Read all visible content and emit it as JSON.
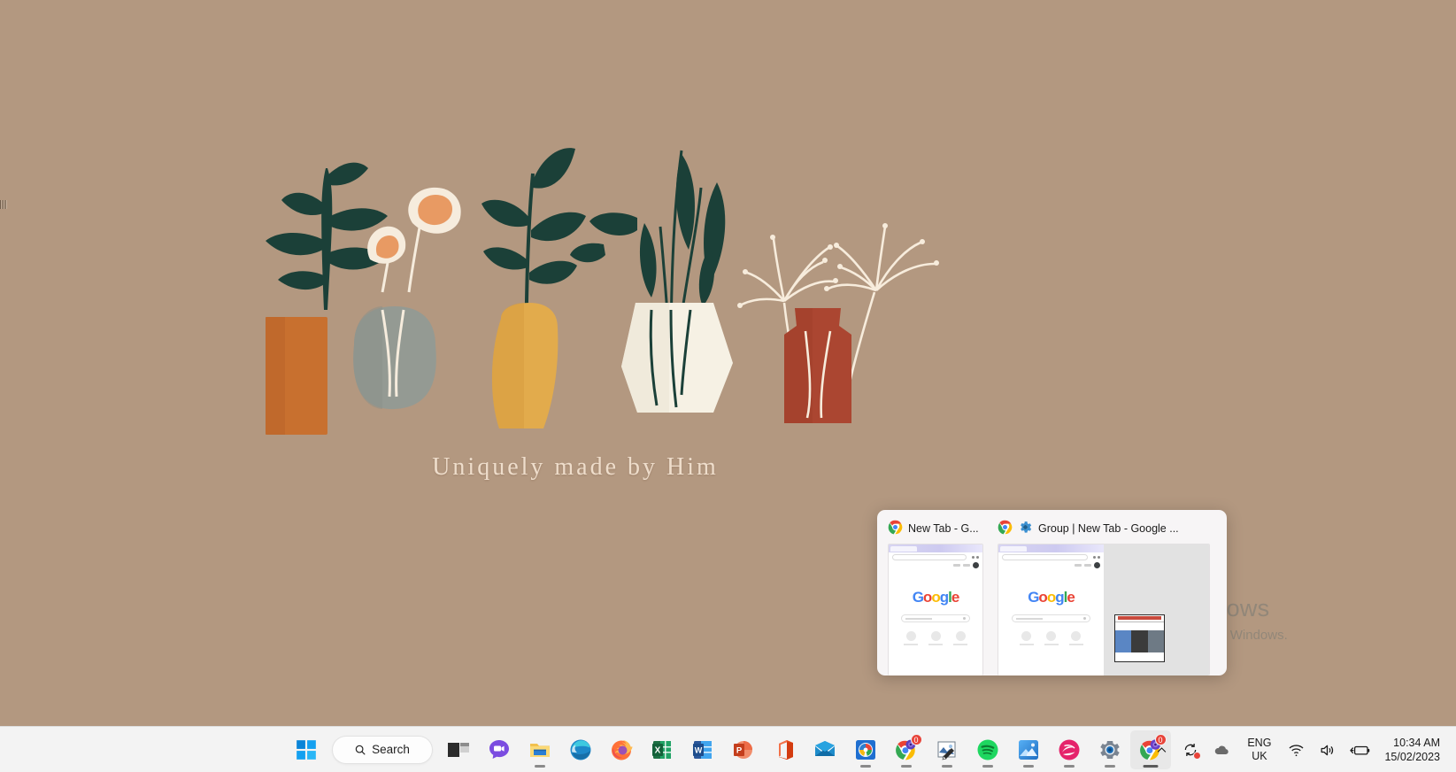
{
  "desktop": {
    "wallpaper": {
      "background_color": "#b39880",
      "caption": "Uniquely made by Him",
      "caption_color": "#f3e3d2",
      "vases": [
        {
          "name": "terracotta-orange-rectangular-vase",
          "color": "#c8702f",
          "plant": "fern-branch",
          "plant_color": "#1b4038"
        },
        {
          "name": "grey-round-vase",
          "color": "#949a93",
          "plant": "two-poppy-flowers",
          "plant_color": "#f5e9d8"
        },
        {
          "name": "mustard-yellow-pear-vase",
          "color": "#e2ab4c",
          "plant": "leafy-branch",
          "plant_color": "#1b4038"
        },
        {
          "name": "cream-white-geometric-vase",
          "color": "#f6f1e4",
          "plant": "tall-leaf-stems",
          "plant_color": "#1b4038"
        },
        {
          "name": "rust-red-bottle-vase",
          "color": "#ab4631",
          "plant": "dandelion-stems",
          "plant_color": "#f7ecdc"
        }
      ]
    }
  },
  "watermark": {
    "title": "Activate Windows",
    "subtitle": "Go to Settings to activate Windows."
  },
  "thumbnail_preview": {
    "items": [
      {
        "name": "chrome-new-tab-thumbnail",
        "title": "New Tab - G...",
        "icons": [
          "chrome-icon"
        ],
        "page": "Google"
      },
      {
        "name": "chrome-group-thumbnail",
        "title": "Group | New Tab - Google ...",
        "icons": [
          "chrome-icon",
          "gear-icon"
        ],
        "page": "Google"
      }
    ],
    "google_letters": [
      "G",
      "o",
      "o",
      "g",
      "l",
      "e"
    ]
  },
  "taskbar": {
    "start": {
      "name": "start-button",
      "label": "Start"
    },
    "search": {
      "placeholder": "Search",
      "label": "Search"
    },
    "items": [
      {
        "name": "taskview-button",
        "icon": "task-view-icon",
        "running": false,
        "badge": null
      },
      {
        "name": "teams-button",
        "icon": "teams-chat-icon",
        "running": false,
        "badge": null
      },
      {
        "name": "file-explorer-button",
        "icon": "folder-icon",
        "running": true,
        "badge": null
      },
      {
        "name": "edge-button",
        "icon": "edge-icon",
        "running": false,
        "badge": null
      },
      {
        "name": "firefox-button",
        "icon": "firefox-icon",
        "running": false,
        "badge": null
      },
      {
        "name": "excel-button",
        "icon": "excel-icon",
        "running": false,
        "badge": null
      },
      {
        "name": "word-button",
        "icon": "word-icon",
        "running": false,
        "badge": null
      },
      {
        "name": "powerpoint-button",
        "icon": "powerpoint-icon",
        "running": false,
        "badge": null
      },
      {
        "name": "office-button",
        "icon": "office-icon",
        "running": false,
        "badge": null
      },
      {
        "name": "mail-button",
        "icon": "mail-icon",
        "running": false,
        "badge": null
      },
      {
        "name": "store-button",
        "icon": "microsoft-store-icon",
        "running": true,
        "badge": null
      },
      {
        "name": "chrome-canary-button",
        "icon": "chrome-canary-icon",
        "running": true,
        "badge": "0"
      },
      {
        "name": "snip-sketch-button",
        "icon": "snip-and-sketch-icon",
        "running": true,
        "badge": null
      },
      {
        "name": "spotify-button",
        "icon": "spotify-icon",
        "running": true,
        "badge": null
      },
      {
        "name": "photos-button",
        "icon": "photos-icon",
        "running": true,
        "badge": null
      },
      {
        "name": "paint3d-button",
        "icon": "paint-3d-icon",
        "running": true,
        "badge": null
      },
      {
        "name": "settings-button",
        "icon": "settings-gear-icon",
        "running": true,
        "badge": null
      },
      {
        "name": "chrome-button",
        "icon": "chrome-icon",
        "running": true,
        "badge": "0",
        "active": true
      }
    ]
  },
  "tray": {
    "overflow": {
      "name": "show-hidden-icons",
      "icon": "chevron-up-icon"
    },
    "onedrive_sync": {
      "name": "onedrive-sync-icon",
      "icon": "sync-arrows-icon",
      "has_alert": true
    },
    "onedrive": {
      "name": "onedrive-icon",
      "icon": "cloud-icon"
    },
    "language": {
      "line1": "ENG",
      "line2": "UK"
    },
    "network": {
      "name": "wifi-icon",
      "icon": "wifi-icon"
    },
    "volume": {
      "name": "volume-icon",
      "icon": "speaker-icon"
    },
    "battery": {
      "name": "battery-icon",
      "icon": "battery-charging-icon"
    },
    "clock": {
      "time": "10:34 AM",
      "date": "15/02/2023"
    }
  }
}
